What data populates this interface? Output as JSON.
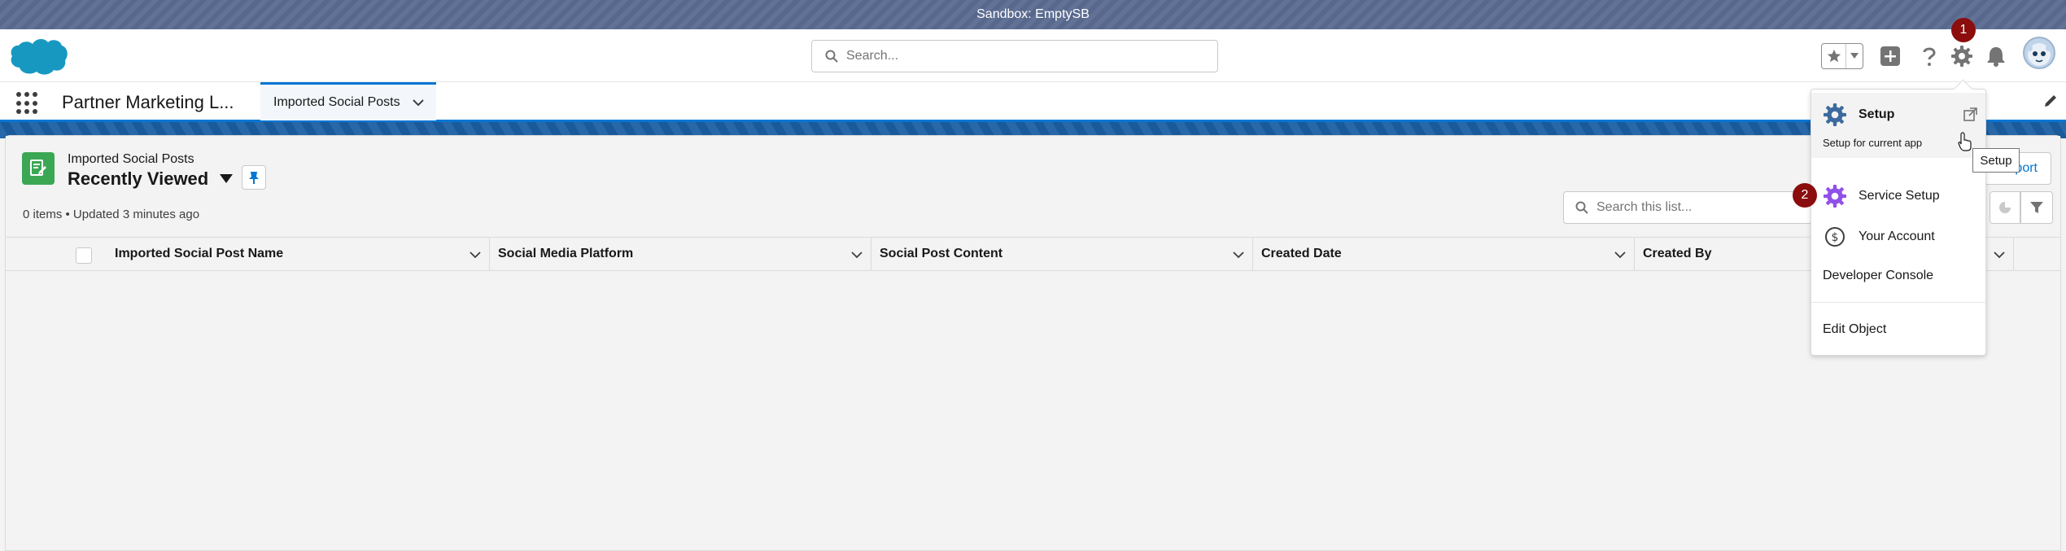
{
  "sandbox": {
    "label": "Sandbox: EmptySB"
  },
  "header": {
    "search_placeholder": "Search...",
    "notification_badge": "1"
  },
  "nav": {
    "app_name": "Partner Marketing L...",
    "tabs": [
      {
        "label": "Imported Social Posts"
      }
    ]
  },
  "list": {
    "object_label": "Imported Social Posts",
    "view_name": "Recently Viewed",
    "meta": "0 items • Updated 3 minutes ago",
    "search_placeholder": "Search this list...",
    "import_label": "Import",
    "columns": [
      {
        "label": "Imported Social Post Name"
      },
      {
        "label": "Social Media Platform"
      },
      {
        "label": "Social Post Content"
      },
      {
        "label": "Created Date"
      },
      {
        "label": "Created By"
      }
    ]
  },
  "setup_menu": {
    "items": [
      {
        "label": "Setup",
        "sublabel": "Setup for current app"
      },
      {
        "label": "Service Setup"
      },
      {
        "label": "Your Account"
      },
      {
        "label": "Developer Console"
      },
      {
        "label": "Edit Object"
      }
    ],
    "step_badge": "2",
    "tooltip": "Setup"
  },
  "colors": {
    "brand_blue": "#0176d3",
    "sandbox_bar": "#5a6b91",
    "object_icon": "#3ba755",
    "badge": "#8b0d0d",
    "service_setup_icon": "#9050e9",
    "setup_icon": "#3c6a9e"
  },
  "icons": {
    "logo": "salesforce-cloud-logo",
    "search": "search-icon",
    "favorites": "star-icon",
    "add": "plus-icon",
    "help": "help-icon",
    "setup": "gear-icon",
    "notifications": "bell-icon",
    "launcher": "app-launcher-icon"
  }
}
